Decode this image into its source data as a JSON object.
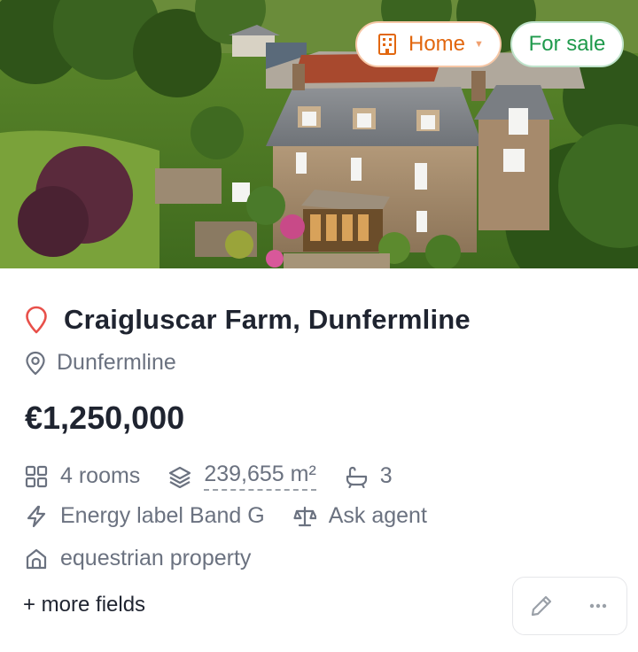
{
  "badges": {
    "type_label": "Home",
    "status_label": "For sale",
    "type_color": "#e2670f",
    "status_color": "#1f9a4c"
  },
  "listing": {
    "title": "Craigluscar Farm, Dunfermline",
    "location": "Dunfermline",
    "price": "€1,250,000"
  },
  "features": {
    "rooms": "4 rooms",
    "area": "239,655 m²",
    "baths": "3",
    "energy": "Energy label Band G",
    "price_basis": "Ask agent",
    "property_type": "equestrian property"
  },
  "footer": {
    "more_fields": "+ more fields"
  },
  "icons": {
    "title_pin": "map-pin-icon",
    "location_pin": "location-pin-icon",
    "rooms": "grid-icon",
    "area": "layers-icon",
    "baths": "bathtub-icon",
    "energy": "lightning-icon",
    "price_basis": "scale-icon",
    "property_type": "house-icon",
    "edit": "pencil-icon",
    "more": "ellipsis-icon"
  }
}
